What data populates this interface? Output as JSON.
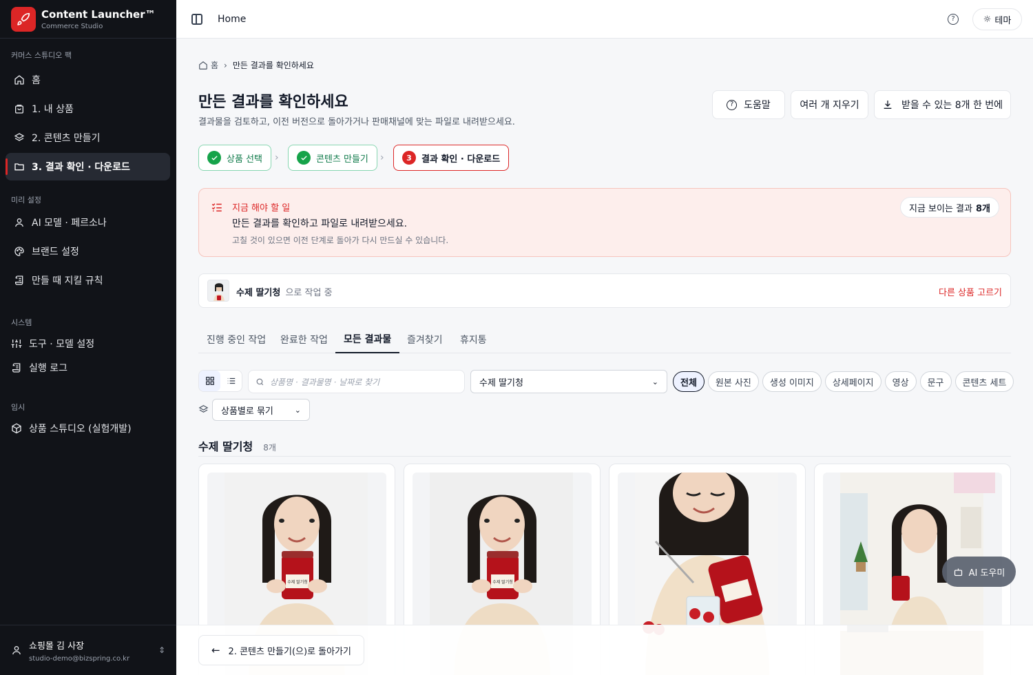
{
  "brand": {
    "title": "Content Launcher™",
    "subtitle": "Commerce Studio"
  },
  "sidebar": {
    "sections": [
      "커머스 스튜디오 팩",
      "미리 설정",
      "시스템",
      "임시"
    ],
    "items": [
      {
        "label": "홈",
        "icon": "home-icon"
      },
      {
        "label": "1. 내 상품",
        "icon": "bag-icon"
      },
      {
        "label": "2. 콘텐츠 만들기",
        "icon": "layers-icon"
      },
      {
        "label": "3. 결과 확인 · 다운로드",
        "icon": "folder-icon"
      },
      {
        "label": "AI 모델 · 페르소나",
        "icon": "user-icon"
      },
      {
        "label": "브랜드 설정",
        "icon": "palette-icon"
      },
      {
        "label": "만들 때 지킬 규칙",
        "icon": "scroll-icon"
      },
      {
        "label": "도구 · 모델 설정",
        "icon": "sliders-icon"
      },
      {
        "label": "실행 로그",
        "icon": "scroll-icon"
      },
      {
        "label": "상품 스튜디오 (실험개발)",
        "icon": "box-icon"
      }
    ],
    "user": {
      "name": "쇼핑몰 김 사장",
      "email": "studio-demo@bizspring.co.kr"
    }
  },
  "topbar": {
    "title": "Home",
    "theme_label": "테마"
  },
  "breadcrumb": {
    "home": "홈",
    "current": "만든 결과를 확인하세요"
  },
  "page": {
    "title": "만든 결과를 확인하세요",
    "subtitle": "결과물을 검토하고, 이전 버전으로 돌아가거나 판매채널에 맞는 파일로 내려받으세요.",
    "help_label": "도움말",
    "clear_label": "여러 개 지우기",
    "download_label": "받을 수 있는 8개 한 번에"
  },
  "steps": [
    {
      "label": "상품 선택"
    },
    {
      "label": "콘텐츠 만들기"
    },
    {
      "label": "결과 확인 · 다운로드",
      "number": "3"
    }
  ],
  "todo": {
    "title": "지금 해야 할 일",
    "message": "만든 결과를 확인하고 파일로 내려받으세요.",
    "hint": "고칠 것이 있으면 이전 단계로 돌아가 다시 만드실 수 있습니다.",
    "badge_prefix": "지금 보이는 결과",
    "badge_count": "8개"
  },
  "product_bar": {
    "name": "수제 딸기청",
    "suffix": "으로 작업 중",
    "change_label": "다른 상품 고르기"
  },
  "tabs": [
    "진행 중인 작업",
    "완료한 작업",
    "모든 결과물",
    "즐겨찾기",
    "휴지통"
  ],
  "filters": {
    "search_placeholder": "상품명 · 결과물명 · 날짜로 찾기",
    "product_select": "수제 딸기청",
    "group_select": "상품별로 묶기",
    "chips": [
      "전체",
      "원본 사진",
      "생성 이미지",
      "상세페이지",
      "영상",
      "문구",
      "콘텐츠 세트"
    ]
  },
  "group": {
    "title": "수제 딸기청",
    "count": "8개"
  },
  "jar_label": "수제 딸기청",
  "assistant": {
    "label": "AI 도우미"
  },
  "back_button": {
    "label": "2. 콘텐츠 만들기(으)로 돌아가기"
  },
  "colors": {
    "accent": "#dc2626",
    "success": "#16a34a",
    "sidebar_bg": "#111318"
  }
}
